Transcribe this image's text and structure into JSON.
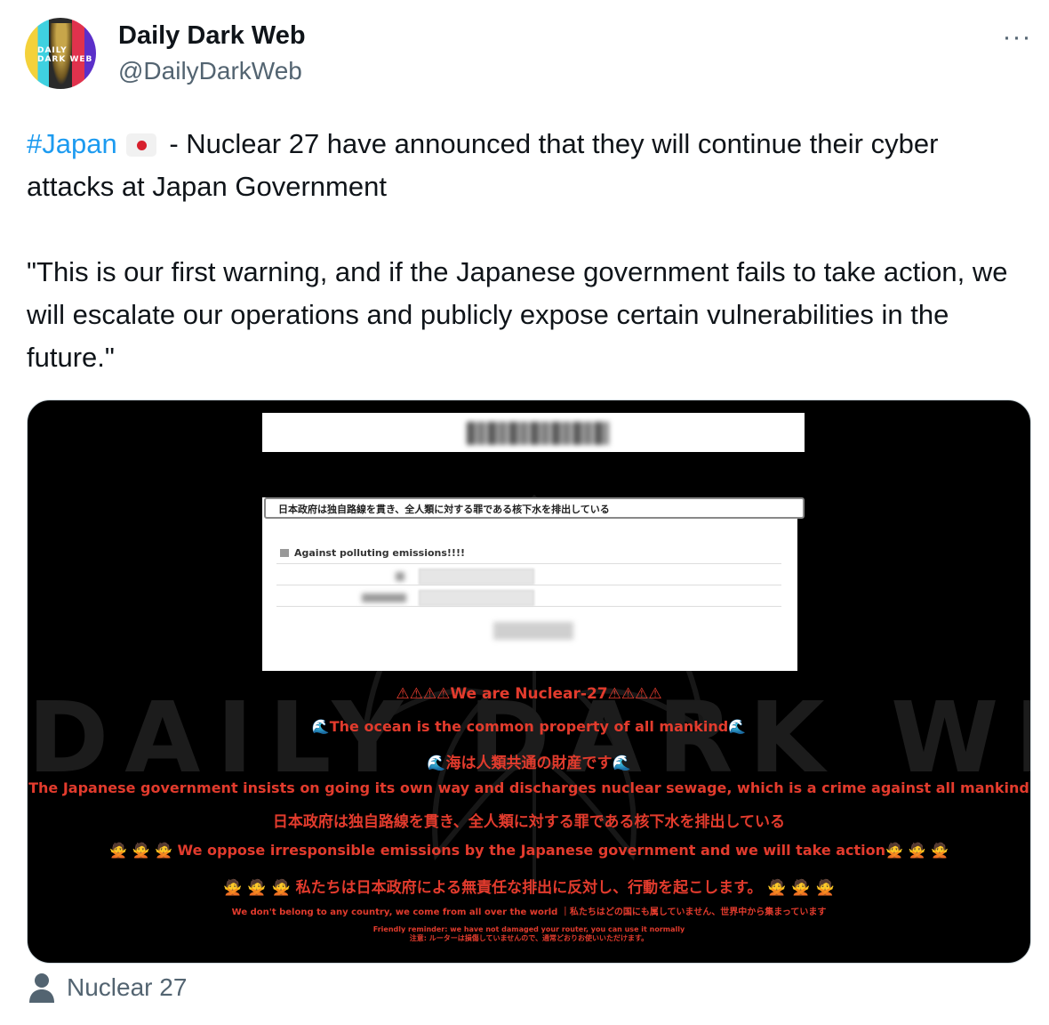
{
  "author": {
    "display_name": "Daily Dark Web",
    "handle": "@DailyDarkWeb",
    "avatar_text": "DAILY DARK WEB"
  },
  "more_icon_glyph": "···",
  "tweet": {
    "hashtag": "#Japan",
    "flag_icon": "japan-flag-icon",
    "line1_rest": " - Nuclear 27 have announced that they will continue their cyber attacks at Japan Government",
    "quote": "\"This is our first warning, and if the Japanese government fails to take action, we will escalate our operations and publicly expose certain vulnerabilities in the future.\""
  },
  "media": {
    "watermark": "DAILY DARK WEB",
    "form_header": "日本政府は独自路線を貫き、全人類に対する罪である核下水を排出している",
    "form_subtitle": "Against polluting emissions!!!!",
    "messages": {
      "m1": "⚠⚠⚠⚠We are Nuclear-27⚠⚠⚠⚠",
      "m2_wave_left": "🌊",
      "m2": "The ocean is the common property of all mankind",
      "m2_wave_right": "🌊",
      "m3_wave_left": "🌊",
      "m3": "海は人類共通の財産です",
      "m3_wave_right": "🌊",
      "m4": "The Japanese government insists on going its own way and discharges nuclear sewage, which is a crime against all mankind",
      "m5": "日本政府は独自路線を貫き、全人類に対する罪である核下水を排出している",
      "m6_left": "🙅 🙅 🙅",
      "m6": "We oppose irresponsible emissions by the Japanese government and we will take action",
      "m6_right": "🙅 🙅 🙅",
      "m7_left": "🙅 🙅 🙅",
      "m7": "私たちは日本政府による無責任な排出に反対し、行動を起こします。",
      "m7_right": "🙅 🙅 🙅",
      "m8": "We don't belong to any country, we come from all over the world ｜私たちはどの国にも属していません、世界中から集まっています",
      "m9a": "Friendly reminder: we have not damaged your router, you can use it normally",
      "m9b": "注意: ルーターは損傷していませんので、通常どおりお使いいただけます。"
    }
  },
  "footer": {
    "icon": "person-icon",
    "label": "Nuclear 27"
  },
  "colors": {
    "link": "#1d9bf0",
    "secondary_text": "#536471",
    "alert_red": "#e23b2d"
  }
}
